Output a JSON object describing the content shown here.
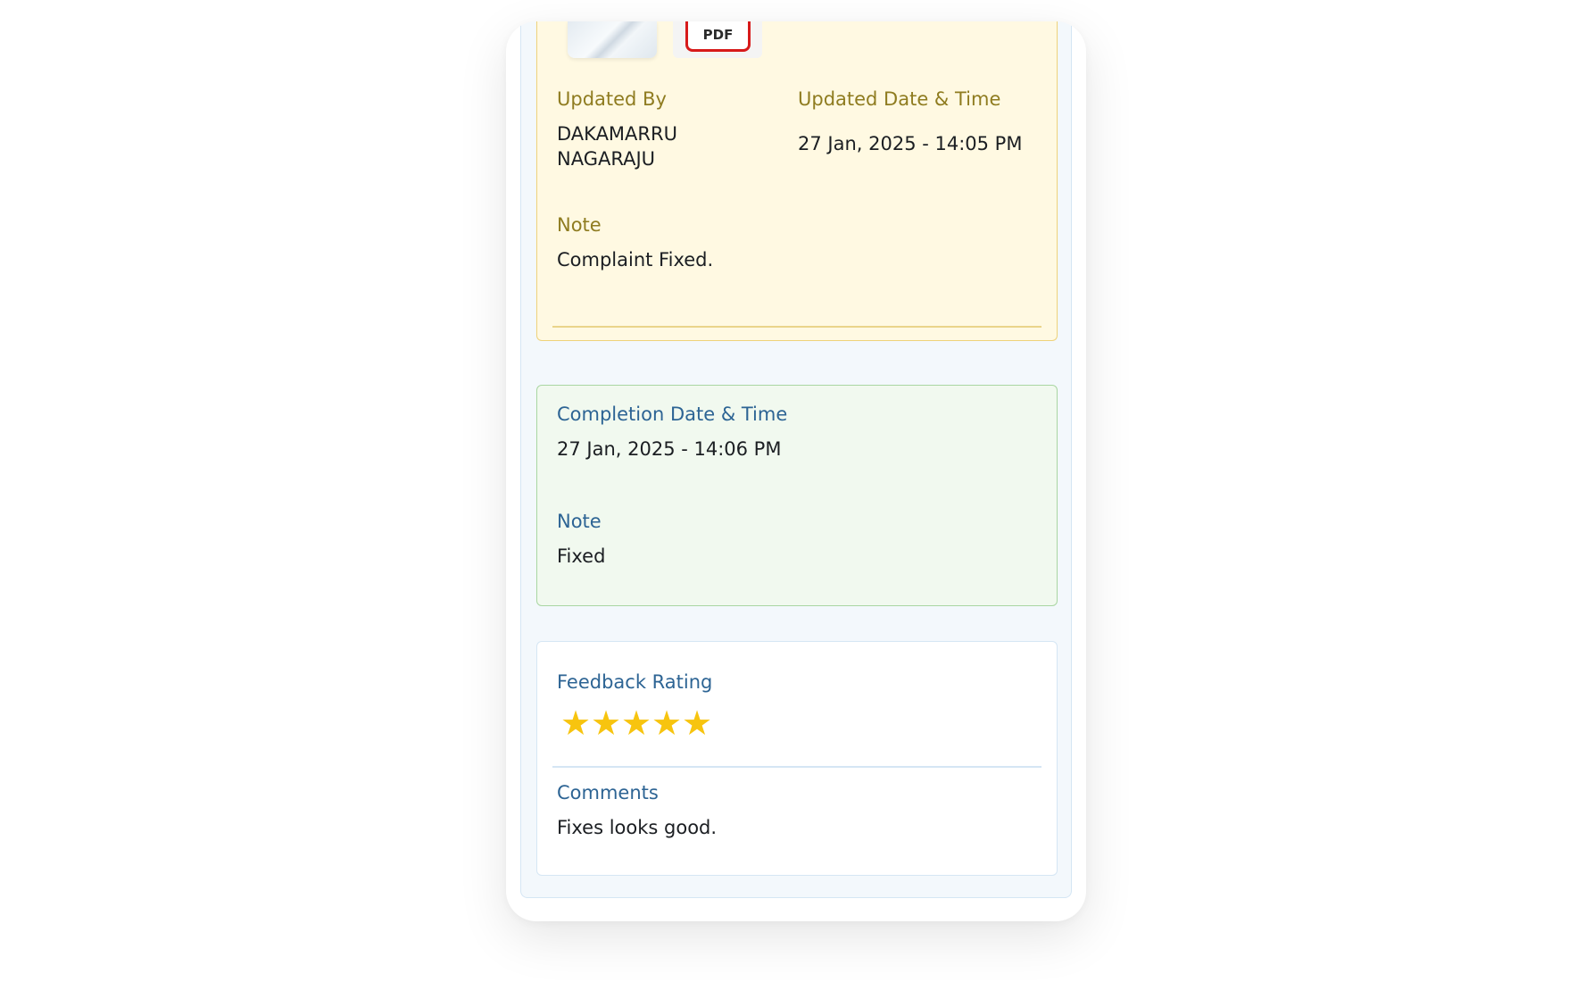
{
  "update_card": {
    "updated_by_label": "Updated By",
    "updated_by_value": "DAKAMARRU NAGARAJU",
    "updated_datetime_label": "Updated Date & Time",
    "updated_datetime_value": "27 Jan, 2025 - 14:05 PM",
    "note_label": "Note",
    "note_value": "Complaint Fixed.",
    "attachments": [
      {
        "type": "image",
        "icon": "image-thumbnail"
      },
      {
        "type": "pdf",
        "icon": "pdf-icon",
        "label": "PDF"
      }
    ]
  },
  "completion_card": {
    "datetime_label": "Completion Date & Time",
    "datetime_value": "27 Jan, 2025 - 14:06 PM",
    "note_label": "Note",
    "note_value": "Fixed"
  },
  "feedback_card": {
    "rating_label": "Feedback Rating",
    "rating_value": 5,
    "rating_max": 5,
    "star_color": "#f7c40f",
    "comments_label": "Comments",
    "comments_value": "Fixes looks good."
  },
  "colors": {
    "update_bg": "#fff9e2",
    "update_border": "#eed27a",
    "completion_bg": "#f1f9ef",
    "completion_border": "#a9d6a2",
    "label_gold": "#8f7c20",
    "label_blue": "#2d6494"
  }
}
